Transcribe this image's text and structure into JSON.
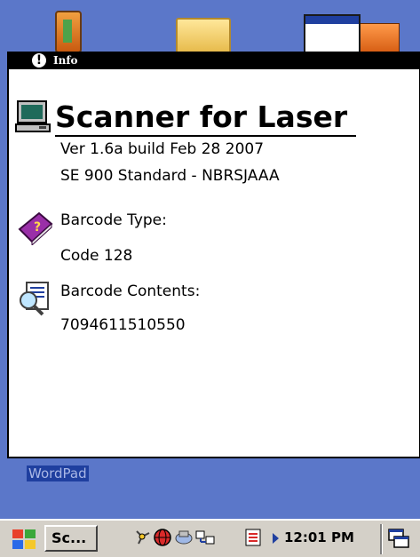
{
  "window": {
    "title": "Info"
  },
  "app": {
    "name": "Scanner for Laser",
    "version": "Ver 1.6a build Feb 28 2007",
    "model": "SE 900 Standard - NBRSJAAA"
  },
  "barcode": {
    "type_label": "Barcode Type:",
    "type_value": "Code 128",
    "contents_label": "Barcode Contents:",
    "contents_value": "7094611510550"
  },
  "desktop": {
    "wordpad_label": "WordPad"
  },
  "taskbar": {
    "task_label": "Sc...",
    "clock": "12:01 PM"
  },
  "colors": {
    "desktop": "#5b77c9",
    "titlebar": "#000000",
    "taskbar": "#d4d0c8"
  }
}
